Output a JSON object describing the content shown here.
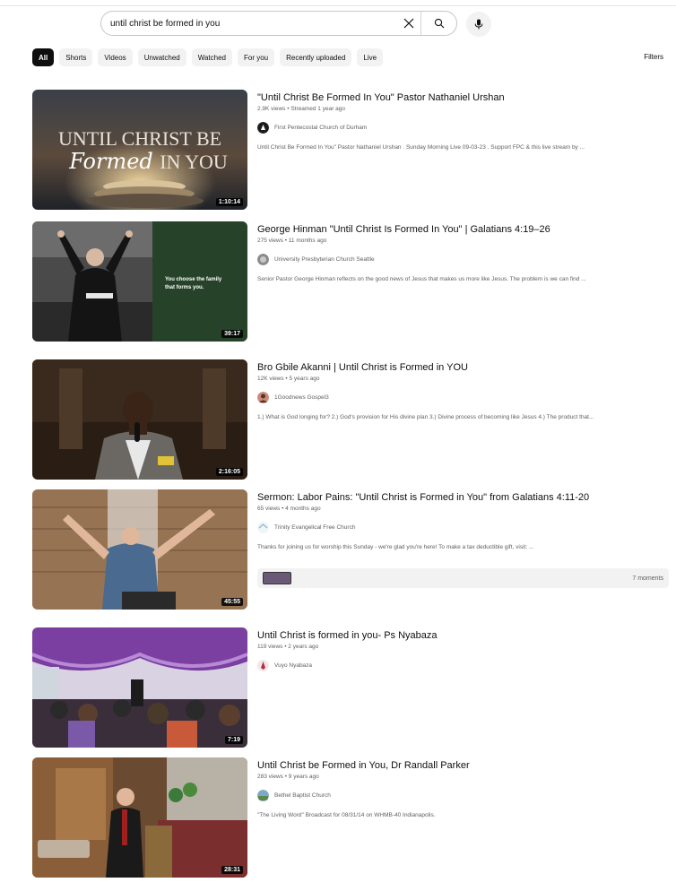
{
  "search": {
    "value": "until christ be formed in you",
    "clear_icon": "close-icon",
    "search_icon": "search-icon",
    "mic_icon": "mic-icon"
  },
  "chips": [
    "All",
    "Shorts",
    "Videos",
    "Unwatched",
    "Watched",
    "For you",
    "Recently uploaded",
    "Live"
  ],
  "active_chip": "All",
  "filters_label": "Filters",
  "results": [
    {
      "title": "\"Until Christ Be Formed In You\" Pastor Nathaniel Urshan",
      "stats": "2.9K views • Streamed 1 year ago",
      "channel": "First Pentecostal Church of Durham",
      "description": "Until Christ Be Formed In You\" Pastor Nathaniel Urshan . Sunday Morning Live 09-03-23 . Support FPC & this live stream by ...",
      "duration": "1:10:14",
      "thumb_text_1": "UNTIL CHRIST BE",
      "thumb_text_2": "Formed",
      "thumb_text_3": "IN YOU"
    },
    {
      "title": "George Hinman \"Until Christ Is Formed In You\" | Galatians 4:19–26",
      "stats": "275 views • 11 months ago",
      "channel": "University Presbyterian Church Seattle",
      "description": "Senior Pastor George Hinman reflects on the good news of Jesus that makes us more like Jesus. The problem is we can find ...",
      "duration": "39:17",
      "thumb_text_1": "You choose the family",
      "thumb_text_2": "that forms you."
    },
    {
      "title": "Bro Gbile Akanni | Until Christ is Formed in YOU",
      "stats": "12K views • 5 years ago",
      "channel": "1Goodnews Gospel3",
      "description": "1.) What is God longing for? 2.) God's provision for His divine plan 3.) Divine process of becoming like Jesus 4.) The product that...",
      "duration": "2:16:05"
    },
    {
      "title": "Sermon: Labor Pains: \"Until Christ is Formed in You\" from Galatians 4:11-20",
      "stats": "65 views • 4 months ago",
      "channel": "Trinity Evangelical Free Church",
      "description": "Thanks for joining us for worship this Sunday - we're glad you're here! To make a tax deductible gift, visit: ...",
      "duration": "45:55",
      "moments_label": "7 moments"
    },
    {
      "title": "Until Christ is formed in you- Ps Nyabaza",
      "stats": "119 views • 2 years ago",
      "channel": "Vuyo Nyabaza",
      "duration": "7:19"
    },
    {
      "title": "Until Christ be Formed in You, Dr Randall Parker",
      "stats": "283 views • 9 years ago",
      "channel": "Bethel Baptist Church",
      "description": "\"The Living Word\" Broadcast for 08/31/14 on WHMB-40 Indianapolis.",
      "duration": "28:31"
    }
  ]
}
